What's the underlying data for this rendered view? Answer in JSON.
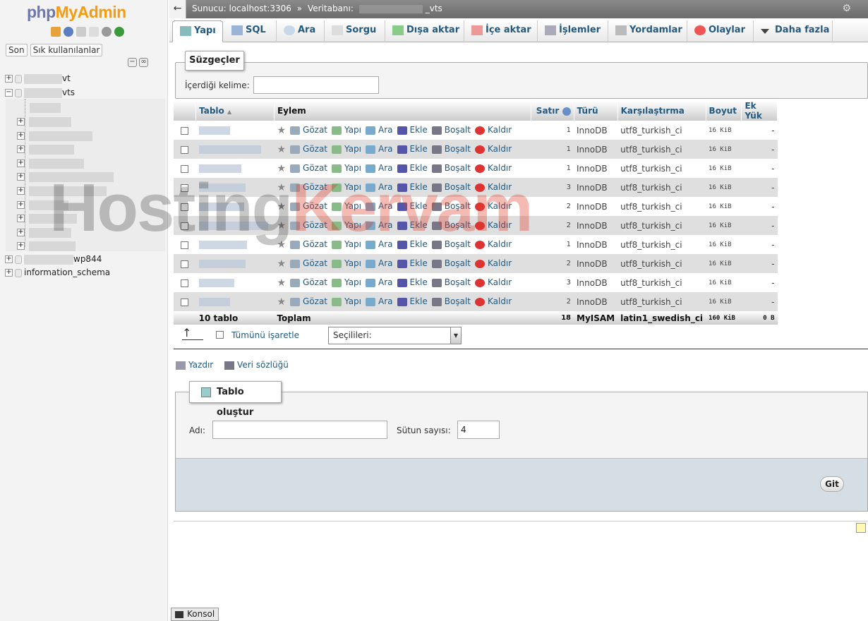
{
  "logo": {
    "part1": "php",
    "part2": "MyAdmin"
  },
  "nav": {
    "btn_recent": "Son",
    "btn_favorites": "Sık kullanılanlar",
    "db1_suffix": "vt",
    "db2_suffix": "vts",
    "db3_suffix": "wp844",
    "db4": "information_schema"
  },
  "topbar": {
    "server": "Sunucu: localhost:3306",
    "sep": "»",
    "db_label": "Veritabanı:",
    "db_suffix": "_vts"
  },
  "tabs": [
    "Yapı",
    "SQL",
    "Ara",
    "Sorgu",
    "Dışa aktar",
    "İçe aktar",
    "İşlemler",
    "Yordamlar",
    "Olaylar",
    "Daha fazla"
  ],
  "filter": {
    "legend": "Süzgeçler",
    "keyword_label": "İçerdiği kelime:"
  },
  "table": {
    "headers": {
      "table": "Tablo",
      "action": "Eylem",
      "rows": "Satır",
      "type": "Türü",
      "collation": "Karşılaştırma",
      "size": "Boyut",
      "overhead": "Ek Yük"
    },
    "actions": [
      "Gözat",
      "Yapı",
      "Ara",
      "Ekle",
      "Boşalt",
      "Kaldır"
    ],
    "rows": [
      {
        "rows": "1",
        "type": "InnoDB",
        "collation": "utf8_turkish_ci",
        "size": "16 KiB",
        "overhead": "-"
      },
      {
        "rows": "1",
        "type": "InnoDB",
        "collation": "utf8_turkish_ci",
        "size": "16 KiB",
        "overhead": "-"
      },
      {
        "rows": "1",
        "type": "InnoDB",
        "collation": "utf8_turkish_ci",
        "size": "16 KiB",
        "overhead": "-"
      },
      {
        "rows": "3",
        "type": "InnoDB",
        "collation": "utf8_turkish_ci",
        "size": "16 KiB",
        "overhead": "-"
      },
      {
        "rows": "2",
        "type": "InnoDB",
        "collation": "utf8_turkish_ci",
        "size": "16 KiB",
        "overhead": "-"
      },
      {
        "rows": "2",
        "type": "InnoDB",
        "collation": "utf8_turkish_ci",
        "size": "16 KiB",
        "overhead": "-"
      },
      {
        "rows": "1",
        "type": "InnoDB",
        "collation": "utf8_turkish_ci",
        "size": "16 KiB",
        "overhead": "-"
      },
      {
        "rows": "2",
        "type": "InnoDB",
        "collation": "utf8_turkish_ci",
        "size": "16 KiB",
        "overhead": "-"
      },
      {
        "rows": "3",
        "type": "InnoDB",
        "collation": "utf8_turkish_ci",
        "size": "16 KiB",
        "overhead": "-"
      },
      {
        "rows": "2",
        "type": "InnoDB",
        "collation": "utf8_turkish_ci",
        "size": "16 KiB",
        "overhead": "-"
      }
    ],
    "total": {
      "count": "10 tablo",
      "label": "Toplam",
      "rows": "18",
      "type": "MyISAM",
      "collation": "latin1_swedish_ci",
      "size": "160 KiB",
      "overhead": "0 B"
    }
  },
  "bulk": {
    "check_all": "Tümünü işaretle",
    "with_selected": "Seçilileri:"
  },
  "links": {
    "print": "Yazdır",
    "dictionary": "Veri sözlüğü"
  },
  "create": {
    "legend": "Tablo oluştur",
    "name_label": "Adı:",
    "cols_label": "Sütun sayısı:",
    "cols_value": "4",
    "go": "Git"
  },
  "console": "Konsol",
  "watermark": {
    "dark": "Hosting",
    "red": "Kervam"
  }
}
